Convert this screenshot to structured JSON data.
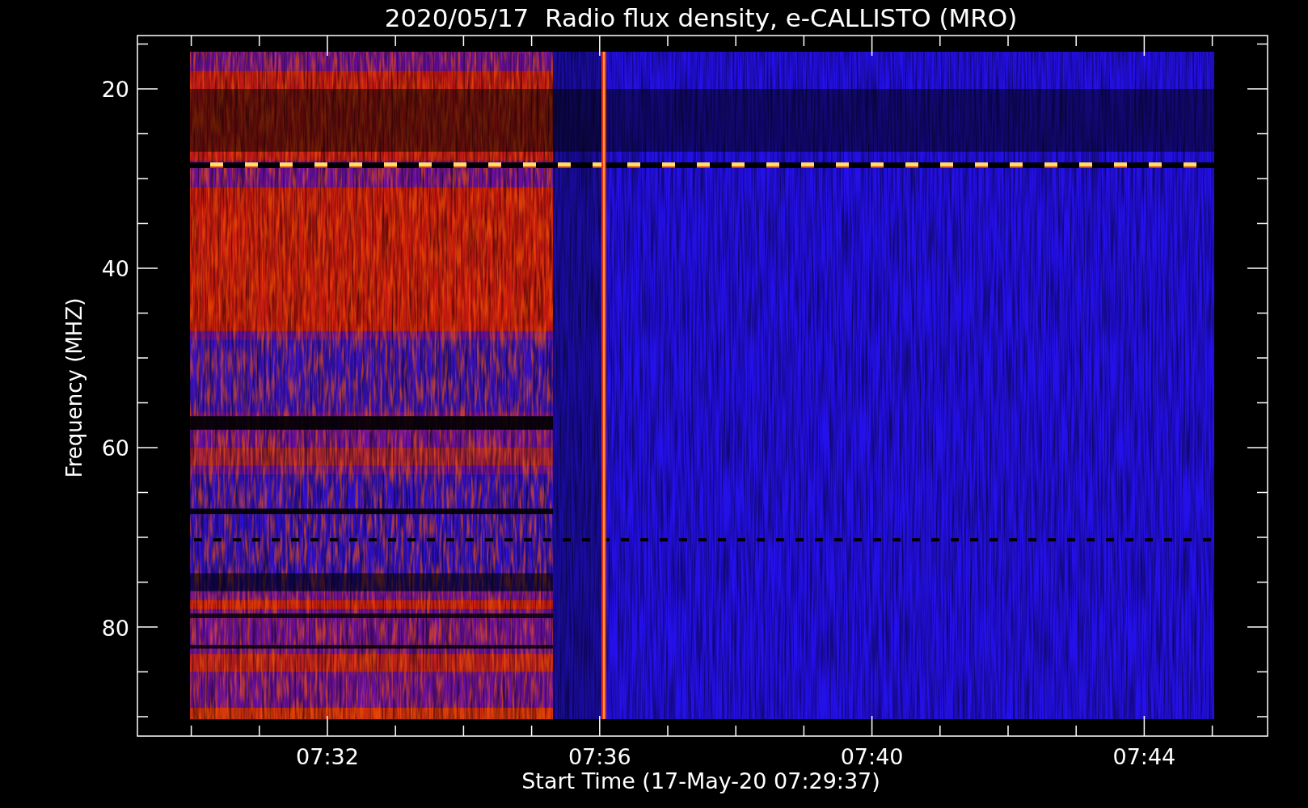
{
  "title": "2020/05/17  Radio flux density, e-CALLISTO (MRO)",
  "y_axis": {
    "label": "Frequency (MHZ)",
    "ticks": [
      "20",
      "40",
      "60",
      "80"
    ]
  },
  "x_axis": {
    "label": "Start Time (17-May-20 07:29:37)",
    "ticks": [
      "07:32",
      "07:36",
      "07:40",
      "07:44"
    ]
  }
}
